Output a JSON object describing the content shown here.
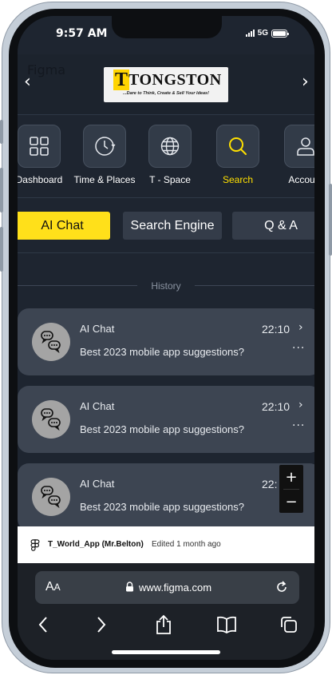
{
  "status_bar": {
    "time": "9:57 AM",
    "network": "5G"
  },
  "header": {
    "figma_label": "Figma",
    "prev_arrow": "‹",
    "next_arrow": "›",
    "logo": {
      "letter": "T",
      "word": "TONGSTON",
      "tagline": "...Dare to Think, Create & Sell Your Ideas!"
    }
  },
  "icon_nav": [
    {
      "label": "Dashboard",
      "icon": "grid-icon",
      "active": false
    },
    {
      "label": "Time & Places",
      "icon": "clock-icon",
      "active": false
    },
    {
      "label": "T - Space",
      "icon": "globe-icon",
      "active": false
    },
    {
      "label": "Search",
      "icon": "search-icon",
      "active": true
    },
    {
      "label": "Account",
      "icon": "user-icon",
      "active": false
    }
  ],
  "tabs": [
    {
      "label": "AI Chat",
      "active": true
    },
    {
      "label": "Search Engine",
      "active": false
    },
    {
      "label": "Q & A",
      "active": false
    }
  ],
  "history": {
    "label": "History",
    "items": [
      {
        "title": "AI Chat",
        "time": "22:10",
        "message": "Best 2023 mobile app suggestions?",
        "more": "···"
      },
      {
        "title": "AI Chat",
        "time": "22:10",
        "message": "Best 2023 mobile app suggestions?",
        "more": "···"
      },
      {
        "title": "AI Chat",
        "time": "22:",
        "message": "Best 2023 mobile app suggestions?",
        "more": ""
      }
    ]
  },
  "zoom": {
    "plus": "+",
    "minus": "−"
  },
  "figma_banner": {
    "file_name": "T_World_App (Mr.Belton)",
    "edited": "Edited 1 month ago"
  },
  "safari": {
    "text_size_big": "A",
    "text_size_small": "A",
    "url": "www.figma.com"
  },
  "colors": {
    "accent": "#ffe01a",
    "background": "#1e2530",
    "card": "#3d4552"
  }
}
